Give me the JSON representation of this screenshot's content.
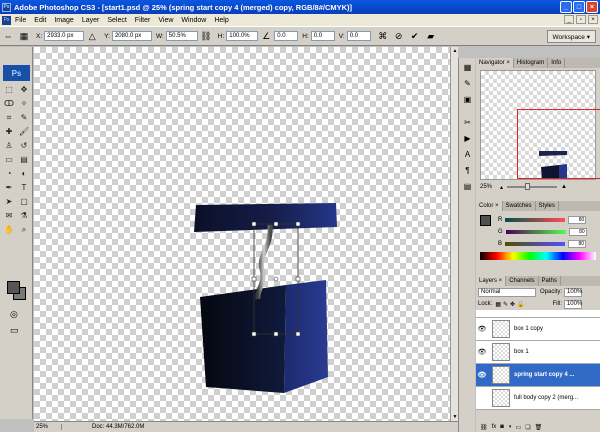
{
  "window": {
    "title": "Adobe Photoshop CS3 - [start1.psd @ 25% (spring start copy 4 (merged) copy, RGB/8#/CMYK)]",
    "controls": [
      "_",
      "□",
      "×"
    ]
  },
  "menubar": {
    "items": [
      "File",
      "Edit",
      "Image",
      "Layer",
      "Select",
      "Filter",
      "View",
      "Window",
      "Help"
    ]
  },
  "options": {
    "x_label": "X:",
    "x_value": "2933.0 px",
    "y_label": "Y:",
    "y_value": "2080.0 px",
    "w_label": "W:",
    "w_value": "50.5%",
    "h_label": "H:",
    "h_value": "100.0%",
    "angle_value": "0.0",
    "hskew_label": "H:",
    "hskew_value": "0.0",
    "vskew_label": "V:",
    "vskew_value": "0.0",
    "workspace_label": "Workspace ▾"
  },
  "toolbox": {
    "logo": "Ps"
  },
  "status": {
    "zoom": "25%",
    "doc": "Doc: 44.3M/762.0M"
  },
  "navigator": {
    "tabs": [
      "Navigator ×",
      "Histogram",
      "Info"
    ],
    "zoom": "25%"
  },
  "color_panel": {
    "tabs": [
      "Color ×",
      "Swatches",
      "Styles"
    ],
    "r_label": "R",
    "r_value": "80",
    "g_label": "G",
    "g_value": "80",
    "b_label": "B",
    "b_value": "80"
  },
  "layers": {
    "tabs": [
      "Layers ×",
      "Channels",
      "Paths"
    ],
    "blend_mode": "Normal",
    "opacity_label": "Opacity:",
    "opacity": "100%",
    "lock_label": "Lock:",
    "fill_label": "Fill:",
    "fill": "100%",
    "rows": [
      {
        "name": "box 1 copy",
        "selected": false
      },
      {
        "name": "box 1",
        "selected": false
      },
      {
        "name": "spring start copy 4 ...",
        "selected": true
      },
      {
        "name": "full body copy 2 (merg...",
        "selected": false
      }
    ]
  },
  "colors": {
    "box_dark": "#0d1330",
    "box_blue": "#1e2f78",
    "selection": "#3169c6"
  }
}
